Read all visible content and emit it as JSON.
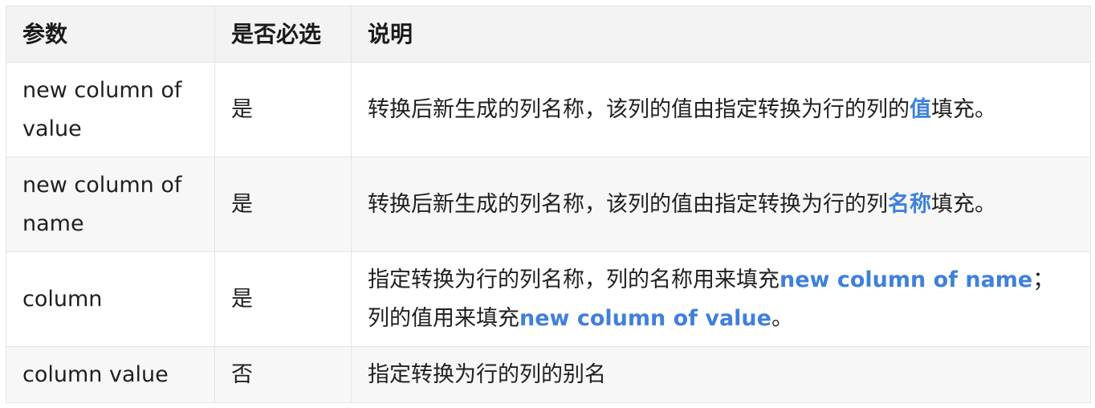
{
  "table": {
    "headers": [
      "参数",
      "是否必选",
      "说明"
    ],
    "rows": [
      {
        "param": "new column of value",
        "required": "是",
        "desc": [
          {
            "text": "转换后新生成的列名称，该列的值由指定转换为行的列的",
            "highlight": false
          },
          {
            "text": "值",
            "highlight": true
          },
          {
            "text": "填充。",
            "highlight": false
          }
        ]
      },
      {
        "param": "new column of name",
        "required": "是",
        "desc": [
          {
            "text": "转换后新生成的列名称，该列的值由指定转换为行的列",
            "highlight": false
          },
          {
            "text": "名称",
            "highlight": true
          },
          {
            "text": "填充。",
            "highlight": false
          }
        ]
      },
      {
        "param": "column",
        "required": "是",
        "desc": [
          {
            "text": "指定转换为行的列名称，列的名称用来填充",
            "highlight": false
          },
          {
            "text": "new column of name",
            "highlight": true
          },
          {
            "text": "；列的值用来填充",
            "highlight": false
          },
          {
            "text": "new column of value",
            "highlight": true
          },
          {
            "text": "。",
            "highlight": false
          }
        ]
      },
      {
        "param": "column value",
        "required": "否",
        "desc": [
          {
            "text": "指定转换为行的列的别名",
            "highlight": false
          }
        ]
      }
    ]
  },
  "colors": {
    "highlight": "#3f80dc",
    "header_bg": "#f3f3f3",
    "border": "#e4e4e4"
  }
}
